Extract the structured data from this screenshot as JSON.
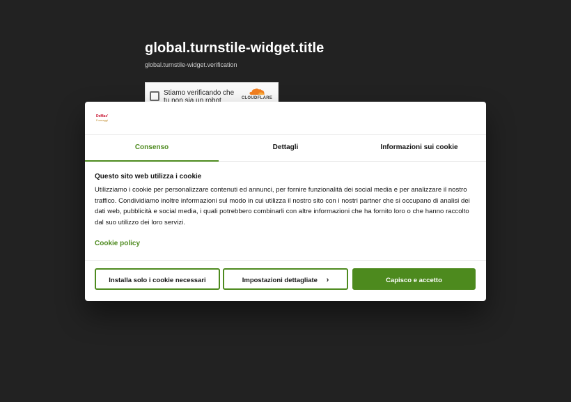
{
  "page": {
    "title": "global.turnstile-widget.title",
    "subtitle": "global.turnstile-widget.verification"
  },
  "turnstile": {
    "checkbox_text": "Stiamo verificando che tu non sia un robot",
    "brand": "CLOUDFLARE",
    "icon": "cloudflare-cloud-icon"
  },
  "cookie_dialog": {
    "logo": {
      "line1": "DeMas'",
      "line2": "Formaggi"
    },
    "tabs": [
      {
        "label": "Consenso",
        "active": true
      },
      {
        "label": "Dettagli",
        "active": false
      },
      {
        "label": "Informazioni sui cookie",
        "active": false
      }
    ],
    "heading": "Questo sito web utilizza i cookie",
    "body": "Utilizziamo i cookie per personalizzare contenuti ed annunci, per fornire funzionalità dei social media e per analizzare il nostro traffico. Condividiamo inoltre informazioni sul modo in cui utilizza il nostro sito con i nostri partner che si occupano di analisi dei dati web, pubblicità e social media, i quali potrebbero combinarli con altre informazioni che ha fornito loro o che hanno raccolto dal suo utilizzo dei loro servizi.",
    "policy_link": "Cookie policy",
    "buttons": {
      "necessary": "Installa solo i cookie necessari",
      "settings": "Impostazioni dettagliate",
      "settings_chevron": "›",
      "accept": "Capisco e accetto"
    }
  },
  "colors": {
    "accent": "#4d8a1e",
    "page_background": "#222222",
    "dialog_background": "#ffffff"
  }
}
